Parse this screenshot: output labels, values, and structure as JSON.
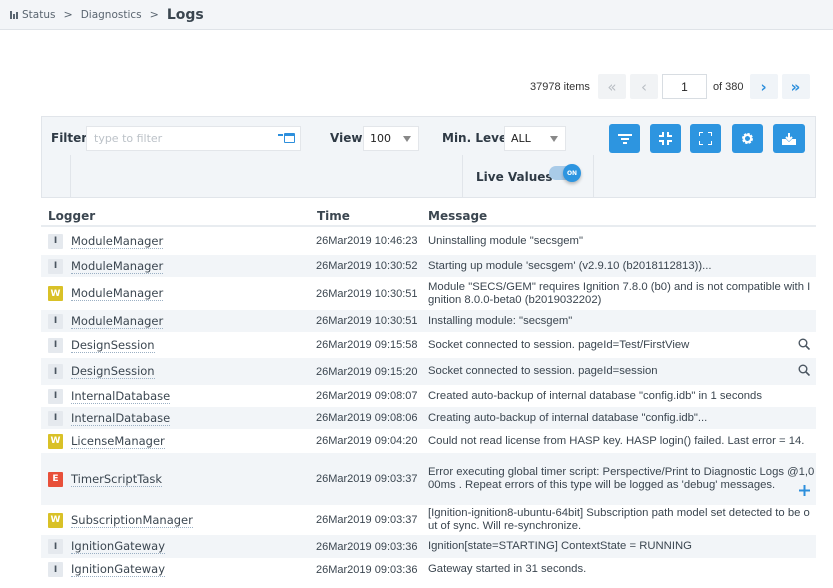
{
  "breadcrumb": {
    "icon": "bar-chart-icon",
    "items": [
      "Status",
      "Diagnostics"
    ],
    "current": "Logs"
  },
  "pager": {
    "count_label": "37978 items",
    "first": "«",
    "prev": "‹",
    "page": "1",
    "of_label": "of 380",
    "next": "›",
    "last": "»"
  },
  "filters": {
    "filter_label": "Filter",
    "filter_placeholder": "type to filter",
    "filter_value": "",
    "view_label": "View",
    "view_value": "100",
    "level_label": "Min. Level",
    "level_value": "ALL",
    "live_label": "Live Values",
    "live_state": "ON",
    "toolbar": [
      "filter-icon",
      "collapse-icon",
      "expand-icon",
      "gear-icon",
      "download-icon"
    ],
    "accent": "#2d95e0"
  },
  "table": {
    "columns": [
      "Logger",
      "Time",
      "Message"
    ],
    "level_colors": {
      "I": "#e5e9ee",
      "W": "#d9c127",
      "E": "#e8503a"
    },
    "rows": [
      {
        "level": "I",
        "logger": "ModuleManager",
        "time": "26Mar2019 10:46:23",
        "message": "Uninstalling module \"secsgem\"",
        "action": ""
      },
      {
        "level": "I",
        "logger": "ModuleManager",
        "time": "26Mar2019 10:30:52",
        "message": "Starting up module 'secsgem' (v2.9.10 (b2018112813))...",
        "action": ""
      },
      {
        "level": "W",
        "logger": "ModuleManager",
        "time": "26Mar2019 10:30:51",
        "message": "Module \"SECS/GEM\" requires Ignition 7.8.0 (b0) and is not compatible with Ignition 8.0.0-beta0 (b2019032202)",
        "action": ""
      },
      {
        "level": "I",
        "logger": "ModuleManager",
        "time": "26Mar2019 10:30:51",
        "message": "Installing module: \"secsgem\"",
        "action": ""
      },
      {
        "level": "I",
        "logger": "DesignSession",
        "time": "26Mar2019 09:15:58",
        "message": "Socket connected to session. pageId=Test/FirstView",
        "action": "search-icon"
      },
      {
        "level": "I",
        "logger": "DesignSession",
        "time": "26Mar2019 09:15:20",
        "message": "Socket connected to session. pageId=session",
        "action": "search-icon"
      },
      {
        "level": "I",
        "logger": "InternalDatabase",
        "time": "26Mar2019 09:08:07",
        "message": "Created auto-backup of internal database \"config.idb\" in 1 seconds",
        "action": ""
      },
      {
        "level": "I",
        "logger": "InternalDatabase",
        "time": "26Mar2019 09:08:06",
        "message": "Creating auto-backup of internal database \"config.idb\"...",
        "action": ""
      },
      {
        "level": "W",
        "logger": "LicenseManager",
        "time": "26Mar2019 09:04:20",
        "message": "Could not read license from HASP key. HASP login() failed. Last error = 14.",
        "action": ""
      },
      {
        "level": "E",
        "logger": "TimerScriptTask",
        "time": "26Mar2019 09:03:37",
        "message": "Error executing global timer script: Perspective/Print to Diagnostic Logs @1,000ms . Repeat errors of this type will be logged as 'debug' messages.",
        "action": "plus-icon"
      },
      {
        "level": "W",
        "logger": "SubscriptionManager",
        "time": "26Mar2019 09:03:37",
        "message": "[Ignition-ignition8-ubuntu-64bit] Subscription path model set detected to be out of sync. Will re-synchronize.",
        "action": ""
      },
      {
        "level": "I",
        "logger": "IgnitionGateway",
        "time": "26Mar2019 09:03:36",
        "message": "Ignition[state=STARTING] ContextState = RUNNING",
        "action": ""
      },
      {
        "level": "I",
        "logger": "IgnitionGateway",
        "time": "26Mar2019 09:03:36",
        "message": "Gateway started in 31 seconds.",
        "action": ""
      }
    ]
  }
}
